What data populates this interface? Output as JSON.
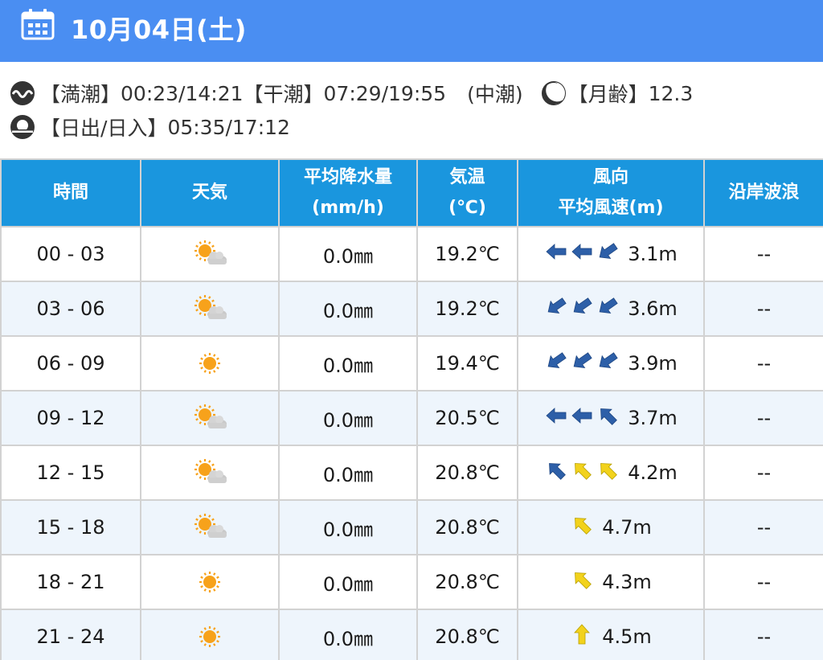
{
  "header": {
    "date": "10月04日(土)"
  },
  "tide": {
    "high_label": "【満潮】",
    "high_value": "00:23/14:21",
    "low_label": "【干潮】",
    "low_value": "07:29/19:55",
    "tide_type": "(中潮)",
    "moon_label": "【月齢】",
    "moon_value": "12.3"
  },
  "sun": {
    "label": "【日出/日入】",
    "value": "05:35/17:12"
  },
  "table": {
    "headers": {
      "time": "時間",
      "weather": "天気",
      "precip_line1": "平均降水量",
      "precip_line2": "(mm/h)",
      "temp_line1": "気温",
      "temp_line2": "(℃)",
      "wind_line1": "風向",
      "wind_line2": "平均風速(m)",
      "wave": "沿岸波浪"
    },
    "rows": [
      {
        "time": "00 - 03",
        "weather_icon": "partly-cloudy-icon",
        "precip": "0.0㎜",
        "temp": "19.2℃",
        "wind_arrows": [
          "left-blue",
          "left-blue",
          "down-left-blue"
        ],
        "wind_speed": "3.1m",
        "wave": "--"
      },
      {
        "time": "03 - 06",
        "weather_icon": "partly-cloudy-icon",
        "precip": "0.0㎜",
        "temp": "19.2℃",
        "wind_arrows": [
          "down-left-blue",
          "down-left-blue",
          "down-left-blue"
        ],
        "wind_speed": "3.6m",
        "wave": "--"
      },
      {
        "time": "06 - 09",
        "weather_icon": "sun-icon",
        "precip": "0.0㎜",
        "temp": "19.4℃",
        "wind_arrows": [
          "down-left-blue",
          "down-left-blue",
          "down-left-blue"
        ],
        "wind_speed": "3.9m",
        "wave": "--"
      },
      {
        "time": "09 - 12",
        "weather_icon": "partly-cloudy-icon",
        "precip": "0.0㎜",
        "temp": "20.5℃",
        "wind_arrows": [
          "left-blue",
          "left-blue",
          "up-left-blue"
        ],
        "wind_speed": "3.7m",
        "wave": "--"
      },
      {
        "time": "12 - 15",
        "weather_icon": "partly-cloudy-icon",
        "precip": "0.0㎜",
        "temp": "20.8℃",
        "wind_arrows": [
          "up-left-blue",
          "up-left-yellow",
          "up-left-yellow"
        ],
        "wind_speed": "4.2m",
        "wave": "--"
      },
      {
        "time": "15 - 18",
        "weather_icon": "partly-cloudy-icon",
        "precip": "0.0㎜",
        "temp": "20.8℃",
        "wind_arrows": [
          "up-left-yellow"
        ],
        "wind_speed": "4.7m",
        "wave": "--"
      },
      {
        "time": "18 - 21",
        "weather_icon": "sun-icon",
        "precip": "0.0㎜",
        "temp": "20.8℃",
        "wind_arrows": [
          "up-left-yellow"
        ],
        "wind_speed": "4.3m",
        "wave": "--"
      },
      {
        "time": "21 - 24",
        "weather_icon": "sun-icon",
        "precip": "0.0㎜",
        "temp": "20.8℃",
        "wind_arrows": [
          "up-yellow"
        ],
        "wind_speed": "4.5m",
        "wave": "--"
      }
    ]
  },
  "colors": {
    "header_bg": "#4a8ef2",
    "table_header_bg": "#1a96de",
    "row_alt_bg": "#eef5fc",
    "arrow_blue": "#2d5fa8",
    "arrow_yellow": "#f2d21c"
  }
}
